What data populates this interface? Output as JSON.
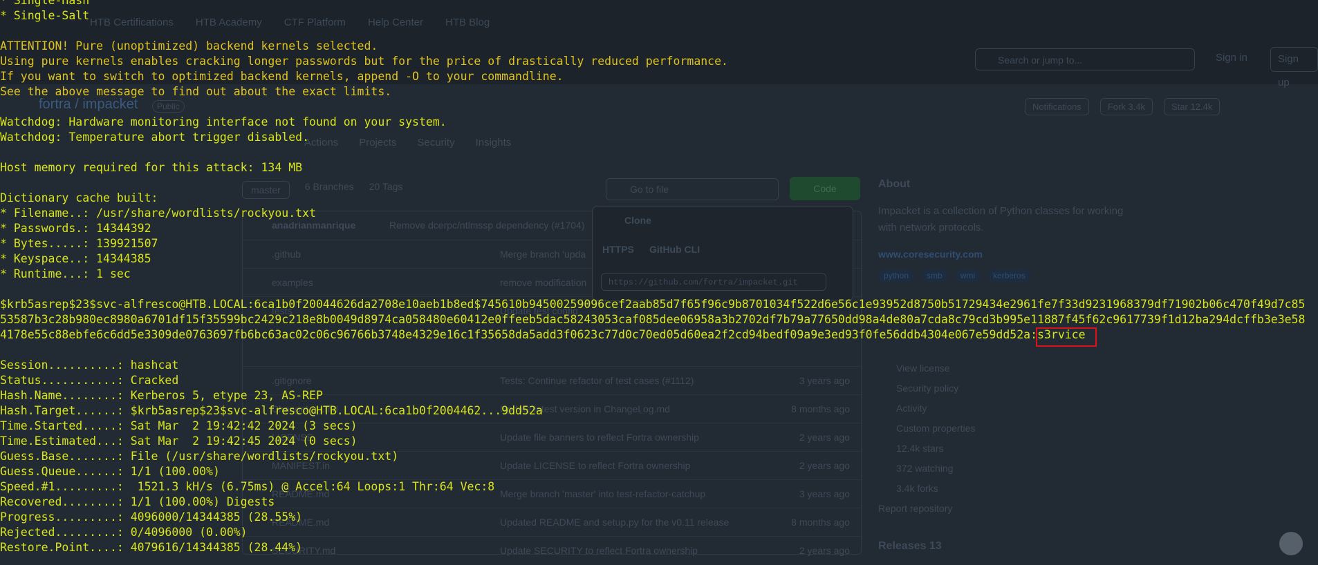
{
  "background": {
    "bookmarks": [
      "HTB Certifications",
      "HTB Academy",
      "CTF Platform",
      "Help Center",
      "HTB Blog"
    ],
    "search_placeholder": "Search or jump to...",
    "sign_in": "Sign in",
    "sign_up": "Sign up",
    "repo_owner": "fortra",
    "repo_name": "impacket",
    "repo_visibility": "Public",
    "notifications": "Notifications",
    "fork": "Fork  3.4k",
    "star": "Star  12.4k",
    "tabs": [
      "Actions",
      "Projects",
      "Security",
      "Insights"
    ],
    "branch": "master",
    "branches": "6 Branches",
    "tags_count": "20 Tags",
    "go_to_file": "Go to file",
    "code_button": "Code",
    "latest_commit_author": "anadrianmanrique",
    "latest_commit_msg": "Remove dcerpc/ntlmssp dependency (#1704)",
    "files": [
      {
        "name": ".github",
        "commit": "Merge branch 'upda",
        "age": ""
      },
      {
        "name": "examples",
        "commit": "remove modification",
        "age": ""
      },
      {
        "name": "tests",
        "commit": "Update test config",
        "age": ""
      },
      {
        "name": ".gitignore",
        "commit": "Tests: Continue refactor of test cases (#1112)",
        "age": "3 years ago"
      },
      {
        "name": "ChangeLog.md",
        "commit": "Update latest version in ChangeLog.md",
        "age": "8 months ago"
      },
      {
        "name": "LICENSE",
        "commit": "Update file banners to reflect Fortra ownership",
        "age": "2 years ago"
      },
      {
        "name": "MANIFEST.in",
        "commit": "Update LICENSE to reflect Fortra ownership",
        "age": "2 years ago"
      },
      {
        "name": "README.md",
        "commit": "Merge branch 'master' into test-refactor-catchup",
        "age": "3 years ago"
      },
      {
        "name": "README.md",
        "commit": "Updated README and setup.py for the v0.11 release",
        "age": "8 months ago"
      },
      {
        "name": "SECURITY.md",
        "commit": "Update SECURITY to reflect Fortra ownership",
        "age": "2 years ago"
      }
    ],
    "clone": {
      "title": "Clone",
      "tab_https": "HTTPS",
      "tab_cli": "GitHub CLI",
      "url": "https://github.com/fortra/impacket.git"
    },
    "about": {
      "heading": "About",
      "description": "Impacket is a collection of Python classes for working with network protocols.",
      "website": "www.coresecurity.com",
      "topics": [
        "python",
        "smb",
        "wmi",
        "kerberos"
      ],
      "links": [
        "View license",
        "Security policy",
        "Activity",
        "Custom properties",
        "12.4k stars",
        "372 watching",
        "3.4k forks",
        "Report repository"
      ]
    },
    "releases": "Releases  13"
  },
  "terminal": {
    "lines_top": [
      "* Single-Hash",
      "* Single-Salt"
    ],
    "attention": [
      "ATTENTION! Pure (unoptimized) backend kernels selected.",
      "Using pure kernels enables cracking longer passwords but for the price of drastically reduced performance.",
      "If you want to switch to optimized backend kernels, append -O to your commandline.",
      "See the above message to find out about the exact limits."
    ],
    "watchdog": [
      "Watchdog: Hardware monitoring interface not found on your system.",
      "Watchdog: Temperature abort trigger disabled."
    ],
    "memory": "Host memory required for this attack: 134 MB",
    "dictionary": [
      "Dictionary cache built:",
      "* Filename..: /usr/share/wordlists/rockyou.txt",
      "* Passwords.: 14344392",
      "* Bytes.....: 139921507",
      "* Keyspace..: 14344385",
      "* Runtime...: 1 sec"
    ],
    "hash_line1": "$krb5asrep$23$svc-alfresco@HTB.LOCAL:6ca1b0f20044626da2708e10aeb1b8ed$745610b94500259096cef2aab85d7f65f96c9b8701034f522d6e56c1e93952d8750b51729434e2961fe7f33d9231968379df71902b06c470f49d7c85",
    "hash_line2": "53587b3c28b980ec8980a6701df15f35599bc2429c218e8b0049d8974ca058480e60412e0ffeeb5dac58243053caf085dee06958a3b2702df7b79a77650dd98a4de80a7cda8c79cd3b995e11887f45f62c9617739f1d12ba294dcffb3e3e58",
    "hash_line3": "4178e55c88ebfe6c6dd5e3309de0763697fb6bc63ac02c06c96766b3748e4329e16c1f35658da5add3f0623c77d0c70ed05d60ea2f2cd94bedf09a9e3ed93f0fe56ddb4304e067e59dd52a",
    "cracked_password": ":s3rvice",
    "status": [
      "Session..........: hashcat",
      "Status...........: Cracked",
      "Hash.Name........: Kerberos 5, etype 23, AS-REP",
      "Hash.Target......: $krb5asrep$23$svc-alfresco@HTB.LOCAL:6ca1b0f2004462...9dd52a",
      "Time.Started.....: Sat Mar  2 19:42:42 2024 (3 secs)",
      "Time.Estimated...: Sat Mar  2 19:42:45 2024 (0 secs)",
      "Guess.Base.......: File (/usr/share/wordlists/rockyou.txt)",
      "Guess.Queue......: 1/1 (100.00%)",
      "Speed.#1.........:  1521.3 kH/s (6.75ms) @ Accel:64 Loops:1 Thr:64 Vec:8",
      "Recovered........: 1/1 (100.00%) Digests",
      "Progress.........: 4096000/14344385 (28.55%)",
      "Rejected.........: 0/4096000 (0.00%)",
      "Restore.Point....: 4079616/14344385 (28.44%)"
    ],
    "colors": {
      "text": "#d9e51c",
      "attention": "#e0c320",
      "highlight_box": "#e0101a"
    }
  }
}
